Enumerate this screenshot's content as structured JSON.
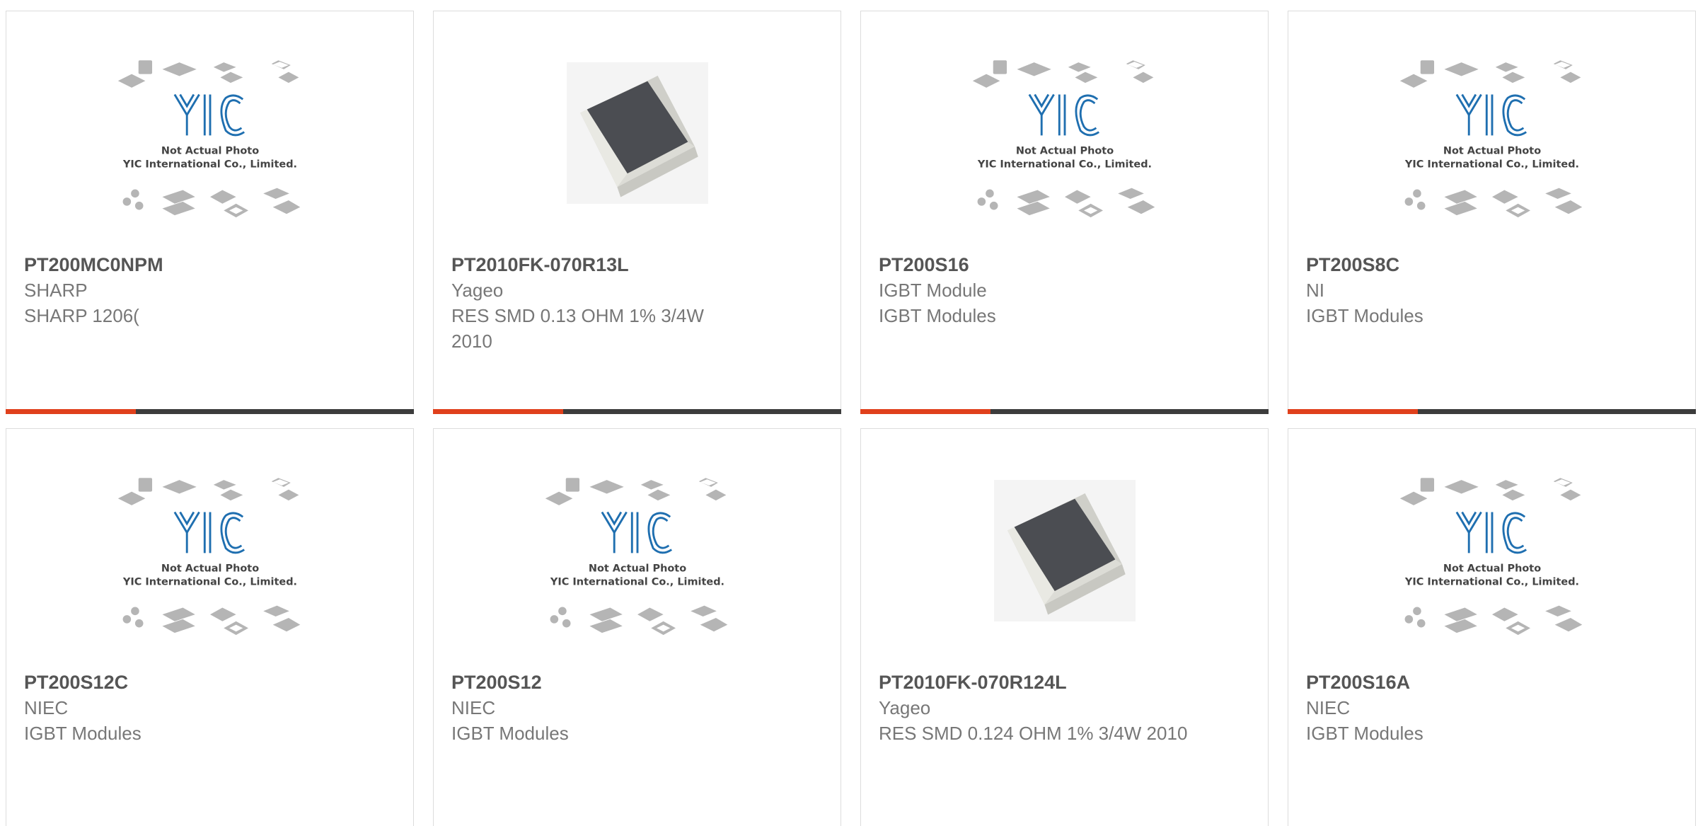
{
  "cards": [
    {
      "part": "PT200MC0NPM",
      "manufacturer": "SHARP",
      "description": "SHARP 1206(",
      "image": "placeholder"
    },
    {
      "part": "PT2010FK-070R13L",
      "manufacturer": "Yageo",
      "description": "RES SMD 0.13 OHM 1% 3/4W 2010",
      "image": "resistor"
    },
    {
      "part": "PT200S16",
      "manufacturer": "IGBT Module",
      "description": "IGBT Modules",
      "image": "placeholder"
    },
    {
      "part": "PT200S8C",
      "manufacturer": "NI",
      "description": "IGBT Modules",
      "image": "placeholder"
    },
    {
      "part": "PT200S12C",
      "manufacturer": "NIEC",
      "description": "IGBT Modules",
      "image": "placeholder"
    },
    {
      "part": "PT200S12",
      "manufacturer": "NIEC",
      "description": "IGBT Modules",
      "image": "placeholder"
    },
    {
      "part": "PT2010FK-070R124L",
      "manufacturer": "Yageo",
      "description": "RES SMD 0.124 OHM 1% 3/4W 2010",
      "image": "resistor"
    },
    {
      "part": "PT200S16A",
      "manufacturer": "NIEC",
      "description": "IGBT Modules",
      "image": "placeholder"
    }
  ],
  "placeholder": {
    "logo": "YIC",
    "line1": "Not Actual Photo",
    "line2": "YIC International Co., Limited."
  },
  "colors": {
    "accent": "#e0401c",
    "bar": "#3c3c3c",
    "logo": "#1f6fb0"
  }
}
